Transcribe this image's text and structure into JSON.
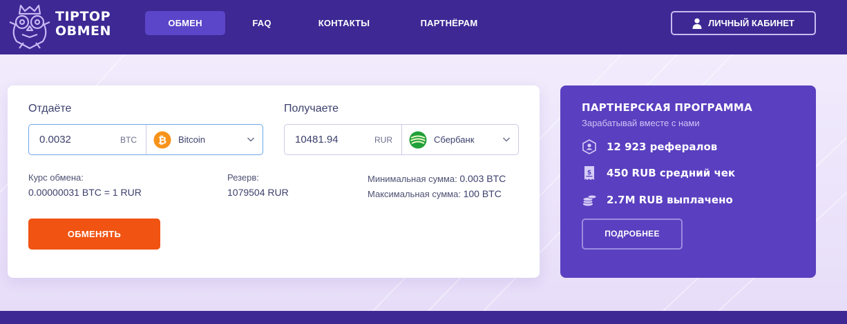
{
  "header": {
    "logo_line1": "TIPTOP",
    "logo_line2": "OBMEN",
    "nav": [
      {
        "label": "ОБМЕН"
      },
      {
        "label": "FAQ"
      },
      {
        "label": "КОНТАКТЫ"
      },
      {
        "label": "ПАРТНЁРАМ"
      }
    ],
    "cabinet_label": "ЛИЧНЫЙ КАБИНЕТ"
  },
  "exchange": {
    "give": {
      "label": "Отдаёте",
      "amount": "0.0032",
      "unit": "BTC",
      "currency": "Bitcoin",
      "icon": "bitcoin-icon"
    },
    "get": {
      "label": "Получаете",
      "amount": "10481.94",
      "unit": "RUR",
      "currency": "Сбербанк",
      "icon": "sberbank-icon"
    },
    "rate_label": "Курс обмена:",
    "rate_value": "0.00000031 BTC = 1 RUR",
    "reserve_label": "Резерв:",
    "reserve_value": "1079504 RUR",
    "min_label": "Минимальная сумма:",
    "min_value": "0.003 BTC",
    "max_label": "Максимальная сумма:",
    "max_value": "100 BTC",
    "button_label": "ОБМЕНЯТЬ"
  },
  "partner": {
    "title": "ПАРТНЕРСКАЯ ПРОГРАММА",
    "subtitle": "Зарабатывай вместе с нами",
    "stats": [
      {
        "icon": "referral-icon",
        "text": "12 923 рефералов"
      },
      {
        "icon": "receipt-icon",
        "text": "450 RUB средний чек"
      },
      {
        "icon": "coins-icon",
        "text": "2.7M RUB выплачено"
      }
    ],
    "button_label": "ПОДРОБНЕЕ"
  },
  "colors": {
    "header_bg": "#3d2894",
    "nav_active": "#5b45c8",
    "exchange_button": "#f05312",
    "partner_bg": "#5a3fc0",
    "bitcoin": "#f7931a",
    "sberbank": "#21a038"
  }
}
